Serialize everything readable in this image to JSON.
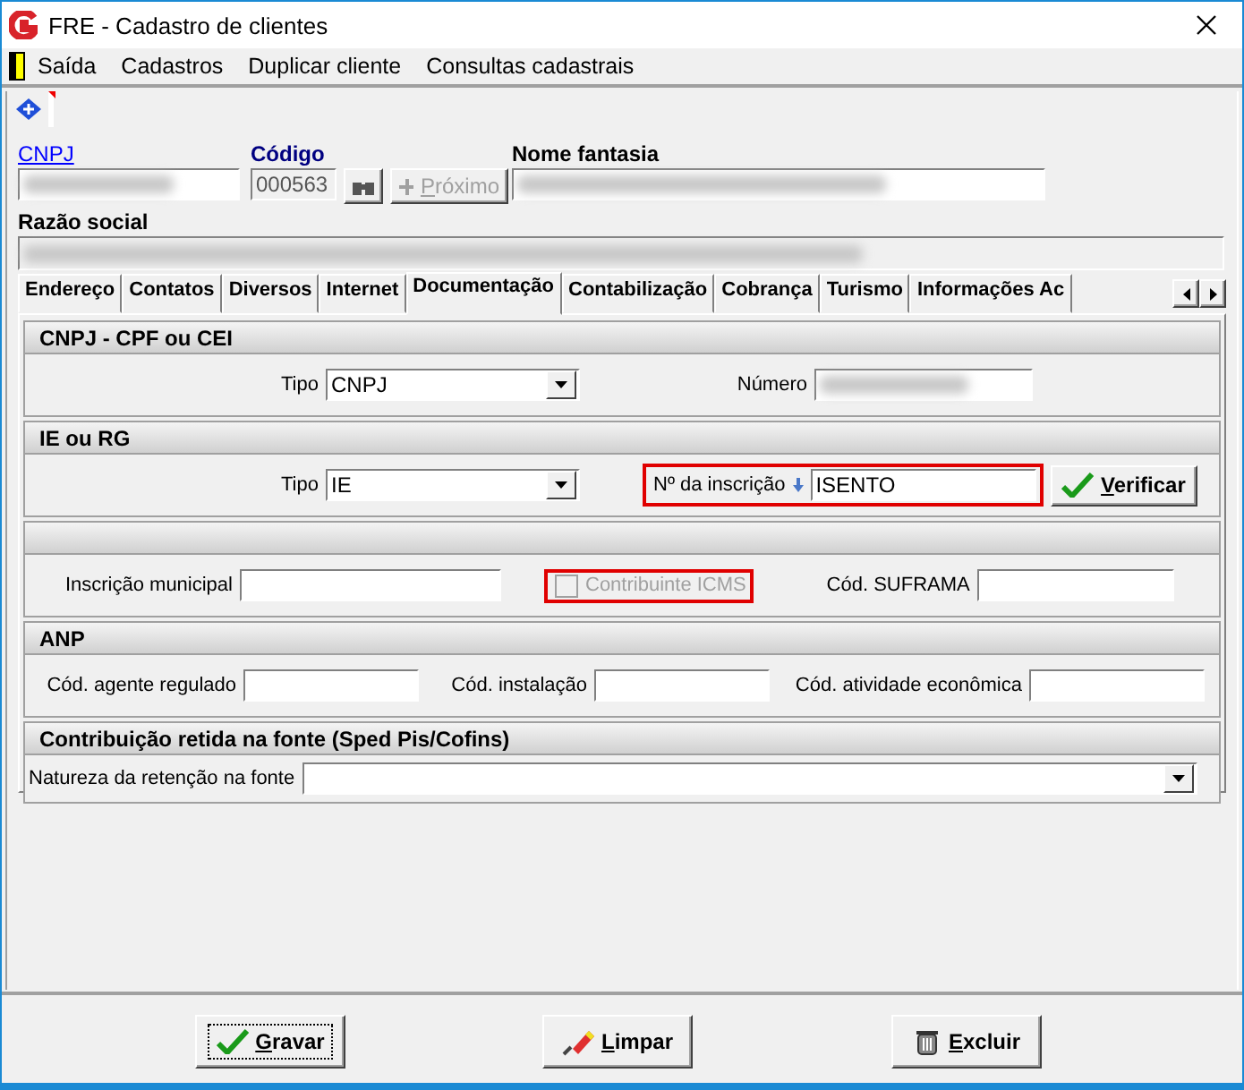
{
  "window": {
    "title": "FRE - Cadastro de clientes"
  },
  "menu": [
    "Saída",
    "Cadastros",
    "Duplicar cliente",
    "Consultas cadastrais"
  ],
  "header": {
    "cnpj_label": "CNPJ",
    "cnpj_redacted": true,
    "codigo_label": "Código",
    "codigo_value": "000563",
    "next_button": "Próximo",
    "next_disabled": true,
    "nome_fantasia_label": "Nome fantasia",
    "nome_fantasia_redacted": true,
    "razao_social_label": "Razão social",
    "razao_social_redacted": true
  },
  "tabs": [
    {
      "label": "Endereço",
      "selected": false
    },
    {
      "label": "Contatos",
      "selected": false
    },
    {
      "label": "Diversos",
      "selected": false
    },
    {
      "label": "Internet",
      "selected": false
    },
    {
      "label": "Documentação",
      "selected": true
    },
    {
      "label": "Contabilização",
      "selected": false
    },
    {
      "label": "Cobrança",
      "selected": false
    },
    {
      "label": "Turismo",
      "selected": false
    },
    {
      "label": "Informações Ac",
      "selected": false
    }
  ],
  "sections": [
    {
      "title": "CNPJ - CPF ou CEI",
      "items": [
        {
          "kind": "select",
          "label": "Tipo",
          "value": "CNPJ"
        },
        {
          "kind": "input",
          "label": "Número",
          "redacted": true
        }
      ]
    },
    {
      "title": "IE ou RG",
      "items": [
        {
          "kind": "select",
          "label": "Tipo",
          "value": "IE"
        },
        {
          "kind": "input",
          "label": "Nº da inscrição",
          "value": "ISENTO",
          "sort_arrow": true,
          "highlighted": true
        },
        {
          "kind": "button",
          "label": "Verificar"
        }
      ]
    },
    {
      "items": [
        {
          "kind": "input",
          "label": "Inscrição municipal"
        },
        {
          "kind": "checkbox",
          "label": "Contribuinte ICMS",
          "checked": false,
          "disabled": true,
          "highlighted": true
        },
        {
          "kind": "input",
          "label": "Cód. SUFRAMA"
        }
      ]
    },
    {
      "title": "ANP",
      "items": [
        {
          "kind": "input",
          "label": "Cód. agente regulado"
        },
        {
          "kind": "input",
          "label": "Cód. instalação"
        },
        {
          "kind": "input",
          "label": "Cód. atividade econômica"
        }
      ]
    },
    {
      "title": "Contribuição retida na fonte  (Sped Pis/Cofins)",
      "items": [
        {
          "kind": "select",
          "label": "Natureza da retenção na fonte"
        }
      ]
    }
  ],
  "buttons": [
    {
      "label": "Gravar",
      "kind": "save",
      "focused": true
    },
    {
      "label": "Limpar",
      "kind": "clear",
      "focused": false
    },
    {
      "label": "Excluir",
      "kind": "delete",
      "focused": false
    }
  ]
}
